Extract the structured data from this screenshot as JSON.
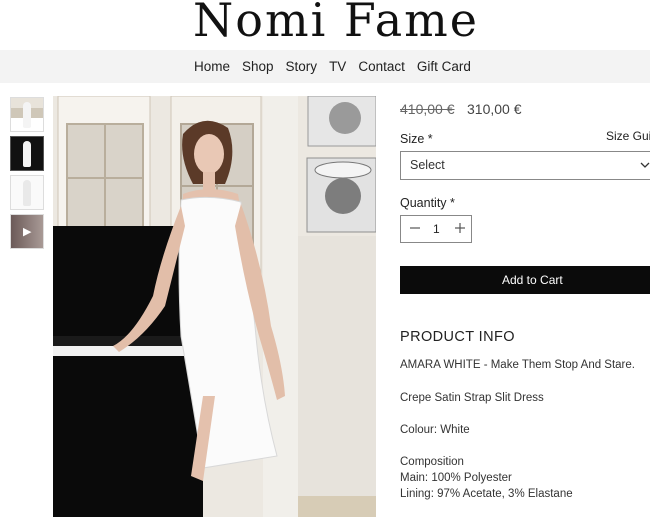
{
  "brand": {
    "name": "Nomi Fame"
  },
  "nav": {
    "items": [
      "Home",
      "Shop",
      "Story",
      "TV",
      "Contact",
      "Gift Card"
    ]
  },
  "gallery": {
    "thumbnails": [
      "image-thumbnail",
      "image-thumbnail",
      "image-thumbnail",
      "video-thumbnail"
    ],
    "play_icon": "play-icon"
  },
  "product": {
    "old_price": "410,00 €",
    "price": "310,00 €",
    "size_label": "Size *",
    "size_guide": "Size Guic",
    "size_select": "Select",
    "quantity_label": "Quantity *",
    "quantity": "1",
    "add_to_cart": "Add to Cart",
    "colors": {
      "button_bg": "#0b0b0b",
      "button_text": "#ffffff"
    }
  },
  "info": {
    "title": "PRODUCT INFO",
    "headline": "AMARA WHITE - Make Them Stop And Stare.",
    "description": "Crepe Satin Strap Slit Dress",
    "colour": "Colour: White",
    "composition_title": "Composition",
    "composition_main": "Main: 100% Polyester",
    "composition_lining": "Lining: 97% Acetate, 3% Elastane"
  }
}
